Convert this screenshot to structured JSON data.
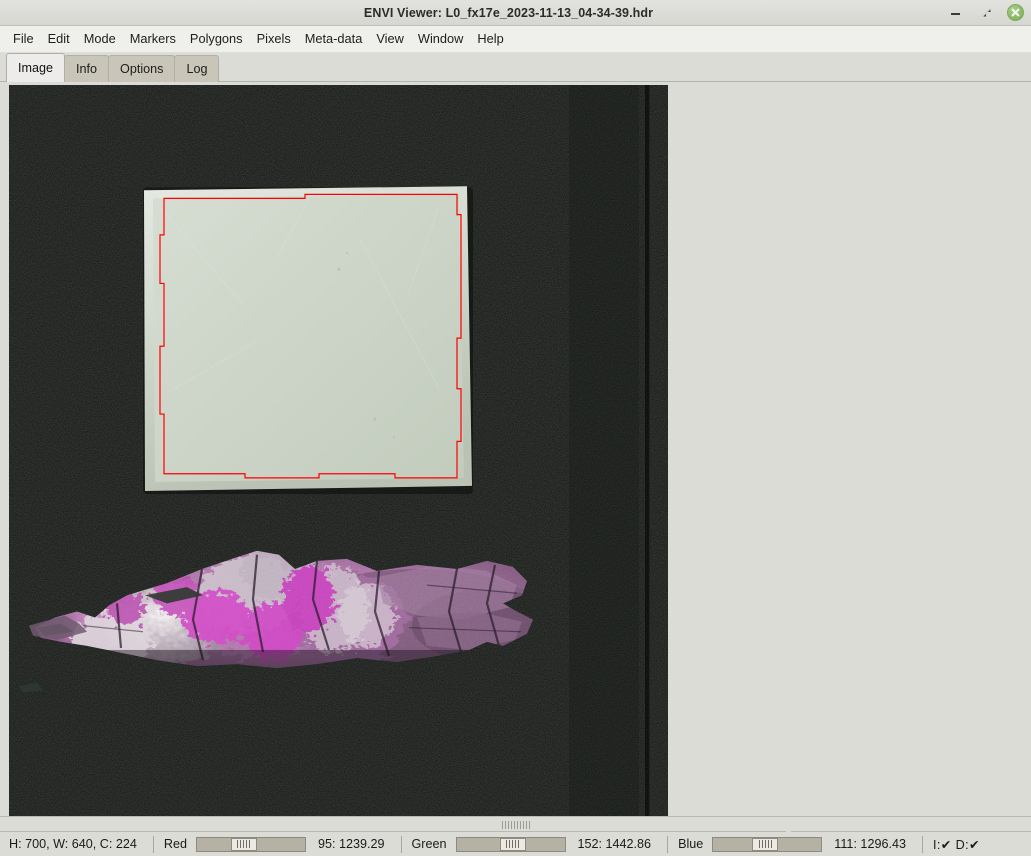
{
  "window": {
    "title": "ENVI Viewer: L0_fx17e_2023-11-13_04-34-39.hdr",
    "minimize_label": "minimize-icon",
    "maximize_label": "restore-icon",
    "close_label": "close-icon",
    "close_color": "#8cbb6a"
  },
  "menubar": {
    "items": [
      {
        "label": "File"
      },
      {
        "label": "Edit"
      },
      {
        "label": "Mode"
      },
      {
        "label": "Markers"
      },
      {
        "label": "Polygons"
      },
      {
        "label": "Pixels"
      },
      {
        "label": "Meta-data"
      },
      {
        "label": "View"
      },
      {
        "label": "Window"
      },
      {
        "label": "Help"
      }
    ]
  },
  "tabs": {
    "active": "Image",
    "items": [
      {
        "label": "Image"
      },
      {
        "label": "Info"
      },
      {
        "label": "Options"
      },
      {
        "label": "Log"
      }
    ]
  },
  "viewer": {
    "roi_color": "#ff0000",
    "background_color": "#000000",
    "panel_color": "#cdd6c6",
    "specimen_color": "#b47ab0"
  },
  "statusbar": {
    "dimensions": "H: 700, W: 640, C: 224",
    "bands": [
      {
        "name": "Red",
        "value": "95: 1239.29",
        "slider_pos_pct": 42
      },
      {
        "name": "Green",
        "value": "152: 1442.86",
        "slider_pos_pct": 52
      },
      {
        "name": "Blue",
        "value": "111: 1296.43",
        "slider_pos_pct": 48
      }
    ],
    "flags": "I:✔ D:✔"
  }
}
